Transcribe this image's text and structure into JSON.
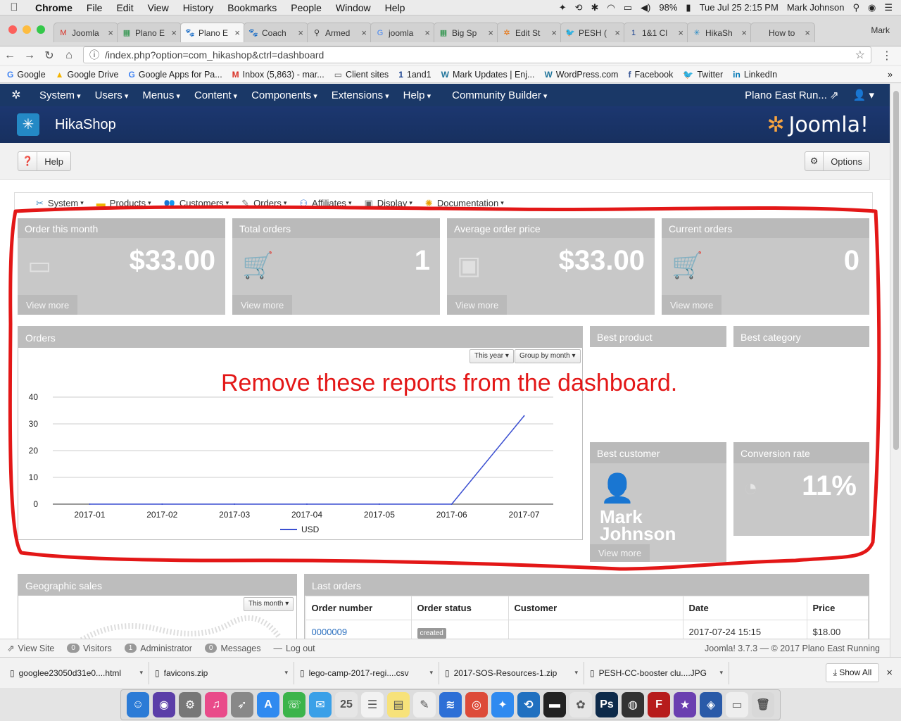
{
  "mac": {
    "app": "Chrome",
    "menus": [
      "File",
      "Edit",
      "View",
      "History",
      "Bookmarks",
      "People",
      "Window",
      "Help"
    ],
    "battery": "98%",
    "datetime": "Tue Jul 25  2:15 PM",
    "user": "Mark Johnson"
  },
  "browser": {
    "tabs": [
      {
        "label": "Joomla",
        "icon": "M",
        "color": "#d93025"
      },
      {
        "label": "Plano E",
        "icon": "▦",
        "color": "#1e8e3e"
      },
      {
        "label": "Plano E",
        "icon": "🐾",
        "color": "#222"
      },
      {
        "label": "Coach",
        "icon": "🐾",
        "color": "#222"
      },
      {
        "label": "Armed",
        "icon": "⚲",
        "color": "#333"
      },
      {
        "label": "joomla",
        "icon": "G",
        "color": "#4285f4"
      },
      {
        "label": "Big Sp",
        "icon": "▦",
        "color": "#1e8e3e"
      },
      {
        "label": "Edit St",
        "icon": "✲",
        "color": "#e8710a"
      },
      {
        "label": "PESH (",
        "icon": "🐦",
        "color": "#1da1f2"
      },
      {
        "label": "1&1 Cl",
        "icon": "1",
        "color": "#143d8d"
      },
      {
        "label": "HikaSh",
        "icon": "✳",
        "color": "#2489c5"
      },
      {
        "label": "How to",
        "icon": "",
        "color": "#333"
      }
    ],
    "active_tab": 2,
    "profile": "Mark",
    "url": "/index.php?option=com_hikashop&ctrl=dashboard",
    "bookmarks": [
      {
        "label": "Google",
        "icon": "G",
        "color": "#4285f4"
      },
      {
        "label": "Google Drive",
        "icon": "▲",
        "color": "#f4b400"
      },
      {
        "label": "Google Apps for Pa...",
        "icon": "G",
        "color": "#4285f4"
      },
      {
        "label": "Inbox (5,863) - mar...",
        "icon": "M",
        "color": "#d93025"
      },
      {
        "label": "Client sites",
        "icon": "▭",
        "color": "#666"
      },
      {
        "label": "1and1",
        "icon": "1",
        "color": "#143d8d"
      },
      {
        "label": "Mark Updates | Enj...",
        "icon": "W",
        "color": "#21759b"
      },
      {
        "label": "WordPress.com",
        "icon": "W",
        "color": "#21759b"
      },
      {
        "label": "Facebook",
        "icon": "f",
        "color": "#3b5998"
      },
      {
        "label": "Twitter",
        "icon": "🐦",
        "color": "#1da1f2"
      },
      {
        "label": "LinkedIn",
        "icon": "in",
        "color": "#0077b5"
      }
    ]
  },
  "joomla": {
    "menus": [
      "System",
      "Users",
      "Menus",
      "Content",
      "Components",
      "Extensions",
      "Help",
      "Community Builder"
    ],
    "site_link": "Plano East Run...",
    "component_title": "HikaShop",
    "brand": "Joomla!",
    "help_label": "Help",
    "options_label": "Options"
  },
  "hika_menu": [
    {
      "label": "System",
      "icon": "✂",
      "color": "#4a90c2"
    },
    {
      "label": "Products",
      "icon": "▬",
      "color": "#f0b400"
    },
    {
      "label": "Customers",
      "icon": "👥",
      "color": "#3a7bd5"
    },
    {
      "label": "Orders",
      "icon": "✎",
      "color": "#777"
    },
    {
      "label": "Affiliates",
      "icon": "⚇",
      "color": "#3a7bd5"
    },
    {
      "label": "Display",
      "icon": "▣",
      "color": "#666"
    },
    {
      "label": "Documentation",
      "icon": "✺",
      "color": "#e8a000"
    }
  ],
  "stats": [
    {
      "title": "Order this month",
      "value": "$33.00",
      "icon": "▭",
      "more": "View more"
    },
    {
      "title": "Total orders",
      "value": "1",
      "icon": "🛒",
      "more": "View more"
    },
    {
      "title": "Average order price",
      "value": "$33.00",
      "icon": "▣",
      "more": "View more"
    },
    {
      "title": "Current orders",
      "value": "0",
      "icon": "🛒",
      "more": "View more"
    }
  ],
  "orders_panel": {
    "title": "Orders",
    "period_btn": "This year",
    "group_btn": "Group by month"
  },
  "chart_data": {
    "type": "line",
    "categories": [
      "2017-01",
      "2017-02",
      "2017-03",
      "2017-04",
      "2017-05",
      "2017-06",
      "2017-07"
    ],
    "series": [
      {
        "name": "USD",
        "values": [
          0,
          0,
          0,
          0,
          0,
          0,
          33
        ],
        "color": "#3b4fd1"
      }
    ],
    "y_ticks": [
      0,
      10,
      20,
      30,
      40
    ],
    "ylim": [
      0,
      40
    ],
    "legend_position": "bottom",
    "grid": true
  },
  "widgets": {
    "best_product": "Best product",
    "best_category": "Best category",
    "best_customer": {
      "title": "Best customer",
      "first": "Mark",
      "last": "Johnson",
      "more": "View more"
    },
    "conversion": {
      "title": "Conversion rate",
      "value": "11%"
    }
  },
  "geo_panel": {
    "title": "Geographic sales",
    "period_btn": "This month"
  },
  "last_orders": {
    "title": "Last orders",
    "columns": [
      "Order number",
      "Order status",
      "Customer",
      "Date",
      "Price"
    ],
    "rows": [
      {
        "number": "0000009",
        "status": "created",
        "customer": "",
        "date": "2017-07-24 15:15",
        "price": "$18.00"
      }
    ]
  },
  "annotation": {
    "text": "Remove these reports from the dashboard.",
    "color": "#e31717"
  },
  "statusbar": {
    "view_site": "View Site",
    "visitors_count": "0",
    "visitors": "Visitors",
    "admin_count": "1",
    "admin": "Administrator",
    "messages_count": "0",
    "messages": "Messages",
    "logout": "Log out",
    "footer": "Joomla! 3.7.3  —  © 2017 Plano East Running"
  },
  "downloads": {
    "items": [
      "googlee23050d31e0....html",
      "favicons.zip",
      "lego-camp-2017-regi....csv",
      "2017-SOS-Resources-1.zip",
      "PESH-CC-booster clu....JPG"
    ],
    "show_all": "Show All"
  },
  "dock": [
    {
      "icon": "☺",
      "color": "#2b7bd6"
    },
    {
      "icon": "◉",
      "color": "#5b3ea8"
    },
    {
      "icon": "⚙",
      "color": "#777"
    },
    {
      "icon": "♫",
      "color": "#e94b8a"
    },
    {
      "icon": "➶",
      "color": "#888"
    },
    {
      "icon": "A",
      "color": "#2f8af0"
    },
    {
      "icon": "☏",
      "color": "#3cb44b"
    },
    {
      "icon": "✉",
      "color": "#3aa0e8"
    },
    {
      "icon": "25",
      "color": "#e6e6e6"
    },
    {
      "icon": "☰",
      "color": "#f2f2f2"
    },
    {
      "icon": "▤",
      "color": "#f7e27a"
    },
    {
      "icon": "✎",
      "color": "#eee"
    },
    {
      "icon": "≋",
      "color": "#2d6fd6"
    },
    {
      "icon": "◎",
      "color": "#dd4b39"
    },
    {
      "icon": "✦",
      "color": "#2f8af0"
    },
    {
      "icon": "⟲",
      "color": "#2070c0"
    },
    {
      "icon": "▬",
      "color": "#222"
    },
    {
      "icon": "✿",
      "color": "#e6e6e6"
    },
    {
      "icon": "Ps",
      "color": "#0d2a4a"
    },
    {
      "icon": "◍",
      "color": "#333"
    },
    {
      "icon": "F",
      "color": "#b71c1c"
    },
    {
      "icon": "★",
      "color": "#6b3fb0"
    },
    {
      "icon": "◈",
      "color": "#2a5aa8"
    },
    {
      "icon": "▭",
      "color": "#eee"
    },
    {
      "icon": "🗑",
      "color": "#d8d8d8"
    }
  ]
}
